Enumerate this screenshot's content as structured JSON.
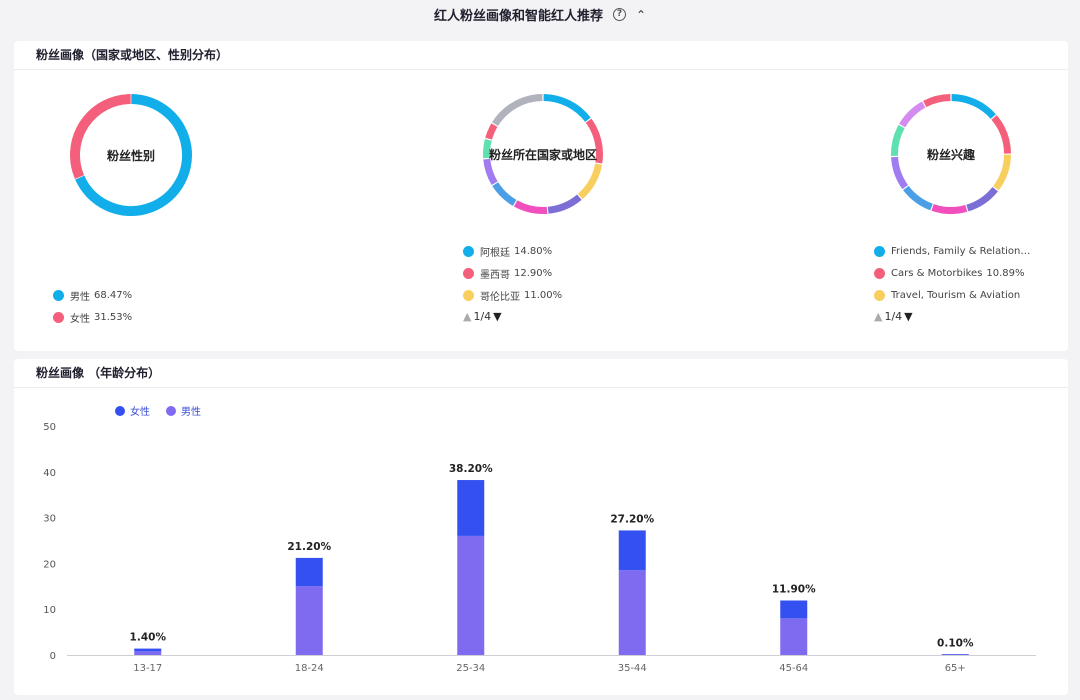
{
  "header": {
    "title": "红人粉丝画像和智能红人推荐",
    "help": "?",
    "collapse": "⌃"
  },
  "demographics": {
    "title": "粉丝画像（国家或地区、性别分布）",
    "gender": {
      "center": "粉丝性别",
      "items": [
        {
          "name": "男性",
          "pct": "68.47%",
          "value": 68.47,
          "color": "#12aeea"
        },
        {
          "name": "女性",
          "pct": "31.53%",
          "value": 31.53,
          "color": "#f4607b"
        }
      ]
    },
    "country": {
      "center": "粉丝所在国家或地区",
      "items": [
        {
          "name": "阿根廷",
          "pct": "14.80%",
          "color": "#12aeea"
        },
        {
          "name": "墨西哥",
          "pct": "12.90%",
          "color": "#f4607b"
        },
        {
          "name": "哥伦比亚",
          "pct": "11.00%",
          "color": "#f8cf5f"
        }
      ],
      "pager": "1/4",
      "segments": [
        {
          "value": 14.8,
          "color": "#12aeea"
        },
        {
          "value": 12.9,
          "color": "#f4607b"
        },
        {
          "value": 11.0,
          "color": "#f8cf5f"
        },
        {
          "value": 10.0,
          "color": "#7b6fd6"
        },
        {
          "value": 9.5,
          "color": "#f04fbd"
        },
        {
          "value": 8.0,
          "color": "#4b9fe6"
        },
        {
          "value": 7.5,
          "color": "#a07cf0"
        },
        {
          "value": 5.5,
          "color": "#5fe0b0"
        },
        {
          "value": 4.5,
          "color": "#f4607b"
        },
        {
          "value": 16.3,
          "color": "#b0b3bc"
        }
      ]
    },
    "interest": {
      "center": "粉丝兴趣",
      "items": [
        {
          "name": "Friends, Family & Relationship",
          "pct": "",
          "color": "#12aeea"
        },
        {
          "name": "Cars & Motorbikes",
          "pct": "10.89%",
          "color": "#f4607b"
        },
        {
          "name": "Travel, Tourism & Aviation",
          "pct": "",
          "color": "#f8cf5f"
        }
      ],
      "pager": "1/4",
      "segments": [
        {
          "value": 13.0,
          "color": "#12aeea"
        },
        {
          "value": 10.89,
          "color": "#f4607b"
        },
        {
          "value": 10.0,
          "color": "#f8cf5f"
        },
        {
          "value": 9.5,
          "color": "#7b6fd6"
        },
        {
          "value": 9.5,
          "color": "#f04fbd"
        },
        {
          "value": 9.0,
          "color": "#4b9fe6"
        },
        {
          "value": 9.0,
          "color": "#a07cf0"
        },
        {
          "value": 8.5,
          "color": "#5fe0b0"
        },
        {
          "value": 8.5,
          "color": "#d58af0"
        },
        {
          "value": 7.5,
          "color": "#f4607b"
        }
      ]
    }
  },
  "age": {
    "title": "粉丝画像 （年龄分布）",
    "legend": [
      {
        "name": "女性",
        "color": "#3450f0"
      },
      {
        "name": "男性",
        "color": "#7f6bf0"
      }
    ]
  },
  "chart_data": {
    "type": "bar",
    "stacked": true,
    "categories": [
      "13-17",
      "18-24",
      "25-34",
      "35-44",
      "45-64",
      "65+"
    ],
    "series": [
      {
        "name": "男性",
        "values": [
          0.8,
          15.0,
          26.0,
          18.5,
          8.0,
          0.05
        ],
        "color": "#7f6bf0"
      },
      {
        "name": "女性",
        "values": [
          0.6,
          6.2,
          12.2,
          8.7,
          3.9,
          0.05
        ],
        "color": "#3450f0"
      }
    ],
    "totals": [
      "1.40%",
      "21.20%",
      "38.20%",
      "27.20%",
      "11.90%",
      "0.10%"
    ],
    "ylim": [
      0,
      50
    ],
    "yticks": [
      0,
      10,
      20,
      30,
      40,
      50
    ],
    "grid": false,
    "legend": "top-left"
  }
}
